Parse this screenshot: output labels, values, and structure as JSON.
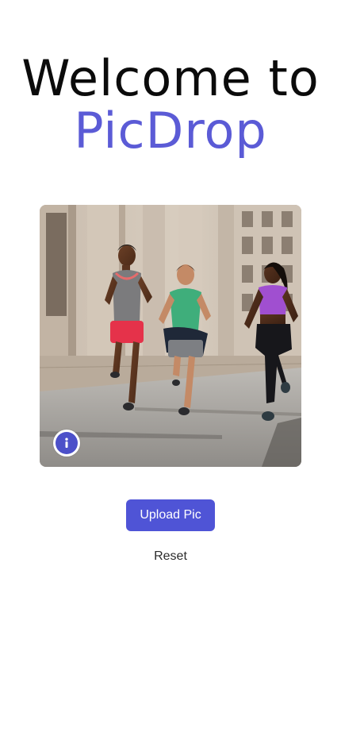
{
  "header": {
    "title_line_1": "Welcome to",
    "title_line_2": "PicDrop"
  },
  "photo": {
    "description_icon": "info-icon"
  },
  "actions": {
    "upload_label": "Upload Pic",
    "reset_label": "Reset"
  },
  "colors": {
    "accent": "#5b5bd6",
    "button": "#4f54d6",
    "title_text": "#0b0b0b",
    "background": "#ffffff"
  }
}
